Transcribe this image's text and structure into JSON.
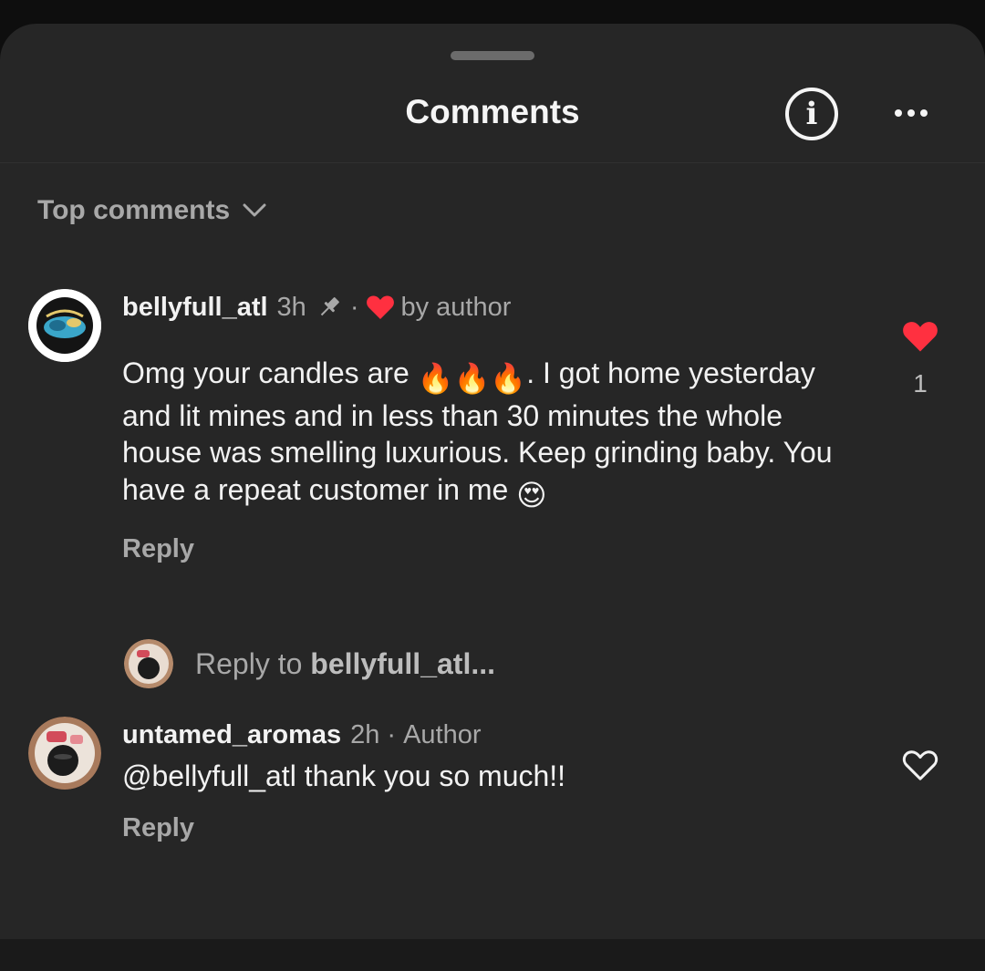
{
  "header": {
    "title": "Comments",
    "info_icon": "info-icon",
    "more_icon": "more-horizontal-icon"
  },
  "sort": {
    "label": "Top comments",
    "icon": "chevron-down-icon"
  },
  "comments": [
    {
      "username": "bellyfull_atl",
      "time": "3h",
      "pinned_icon": "pin-icon",
      "dot": "·",
      "liked_by_author_icon": "heart-icon",
      "liked_by_author_text": "by author",
      "text_before_emoji": "Omg your candles are ",
      "text_after_emoji": ". I got home yesterday and lit mines and in less than 30 minutes the whole house was smelling luxurious. Keep grinding baby. You have a repeat customer in me ",
      "emoji_fire": "🔥🔥🔥",
      "emoji_end": "😍",
      "reply_label": "Reply",
      "like_count": "1",
      "liked": true
    },
    {
      "username": "untamed_aromas",
      "time": "2h",
      "dot": "·",
      "badge": "Author",
      "text": "@bellyfull_atl thank you so much!!",
      "reply_label": "Reply",
      "liked": false
    }
  ],
  "reply_prompt": {
    "prefix": "Reply to ",
    "target": "bellyfull_atl..."
  },
  "colors": {
    "sheet_background": "#262626",
    "like_red": "#ff3040",
    "secondary_text": "#a8a8a8"
  }
}
